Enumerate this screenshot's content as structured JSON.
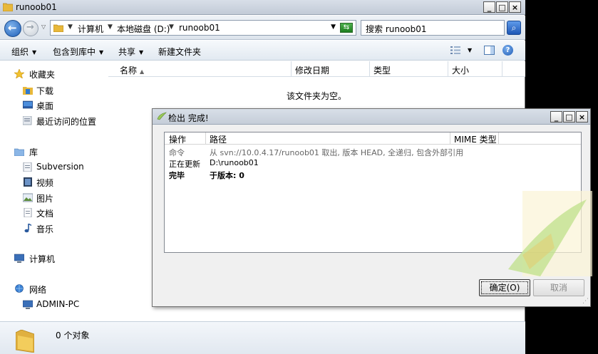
{
  "window": {
    "title": "runoob01"
  },
  "address": {
    "crumbs": [
      "计算机",
      "本地磁盘 (D:)",
      "runoob01"
    ],
    "search_placeholder": "搜索 runoob01"
  },
  "toolbar": {
    "organize": "组织",
    "include_library": "包含到库中",
    "share": "共享",
    "new_folder": "新建文件夹"
  },
  "navpane": {
    "favorites": "收藏夹",
    "downloads": "下载",
    "desktop": "桌面",
    "recent": "最近访问的位置",
    "libraries": "库",
    "subversion": "Subversion",
    "videos": "视频",
    "pictures": "图片",
    "documents": "文档",
    "music": "音乐",
    "computer": "计算机",
    "network": "网络",
    "admin_pc": "ADMIN-PC"
  },
  "columns": {
    "name": "名称",
    "modified": "修改日期",
    "type": "类型",
    "size": "大小"
  },
  "content": {
    "empty_message": "该文件夹为空。"
  },
  "status": {
    "count": "0 个对象"
  },
  "dialog": {
    "title": "检出 完成!",
    "columns": {
      "action": "操作",
      "path": "路径",
      "mime": "MIME 类型"
    },
    "rows": [
      {
        "action": "命令",
        "path": "从 svn://10.0.4.17/runoob01 取出, 版本 HEAD, 全递归, 包含外部引用"
      },
      {
        "action": "正在更新",
        "path": "D:\\runoob01"
      },
      {
        "action": "完毕",
        "path": "于版本: 0"
      }
    ],
    "ok_label": "确定(O)",
    "cancel_label": "取消"
  },
  "colors": {
    "accent": "#1f5fb8",
    "titlebar": "#c5cdd8",
    "logo_green": "#8cc63f"
  }
}
